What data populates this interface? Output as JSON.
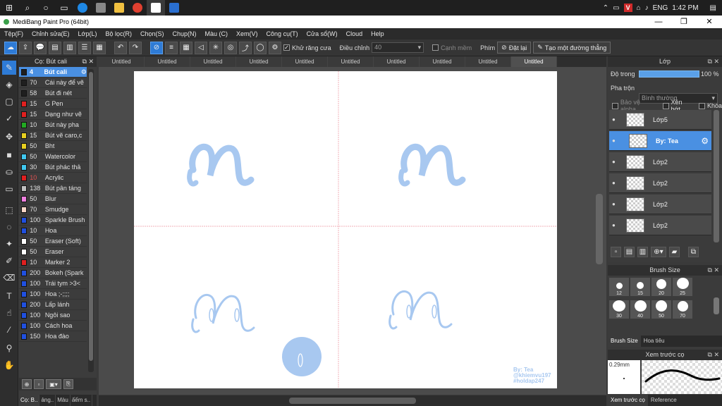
{
  "taskbar": {
    "icons": [
      "windows-logo",
      "search",
      "cortana",
      "task-view",
      "edge",
      "store",
      "explorer",
      "chrome",
      "medibang",
      "app"
    ],
    "tray": {
      "lang": "ENG",
      "time": "1:42 PM"
    }
  },
  "window": {
    "title": "MediBang Paint Pro (64bit)",
    "minimize": "—",
    "maximize": "❐",
    "close": "✕"
  },
  "menu": [
    "Tệp(F)",
    "Chỉnh sửa(E)",
    "Lớp(L)",
    "Bộ lọc(R)",
    "Chọn(S)",
    "Chụp(N)",
    "Màu (C)",
    "Xem(V)",
    "Công cụ(T)",
    "Cửa sổ(W)",
    "Cloud",
    "Help"
  ],
  "toolbar": {
    "antialias_label": "Khử răng cưa",
    "adjust_label": "Điều chỉnh",
    "adjust_value": "40",
    "snap_edge_label": "Cạnh mềm",
    "key_label": "Phím",
    "reset_label": "Đặt lại",
    "make_line_label": "Tạo một đường thẳng"
  },
  "brush_panel": {
    "title": "Cọ: Bút cali",
    "items": [
      {
        "size": "4",
        "name": "Bút cali",
        "color": "#1f1f1f",
        "selected": true
      },
      {
        "size": "70",
        "name": "Cái này để vẽ",
        "color": "#1f1f1f"
      },
      {
        "size": "58",
        "name": "Bút đi nét",
        "color": "#1f1f1f"
      },
      {
        "size": "15",
        "name": "G Pen",
        "color": "#e02020"
      },
      {
        "size": "15",
        "name": "Dạng như vẽ",
        "color": "#e02020"
      },
      {
        "size": "10",
        "name": "Bút này pha",
        "color": "#22aa22"
      },
      {
        "size": "15",
        "name": "Bút vẽ caro,c",
        "color": "#e8d020"
      },
      {
        "size": "50",
        "name": "Bht",
        "color": "#e8d020"
      },
      {
        "size": "50",
        "name": "Watercolor",
        "color": "#40c8f0"
      },
      {
        "size": "30",
        "name": "Bút phác thả",
        "color": "#40c8f0"
      },
      {
        "size": "10",
        "name": "Acrylic",
        "color": "#e02020",
        "accent": true
      },
      {
        "size": "138",
        "name": "Bút pân táng",
        "color": "#c0c0c0"
      },
      {
        "size": "50",
        "name": "Blur",
        "color": "#f080e0"
      },
      {
        "size": "70",
        "name": "Smudge",
        "color": "#f8d8c8"
      },
      {
        "size": "100",
        "name": "Sparkle Brush",
        "color": "#2050e0"
      },
      {
        "size": "10",
        "name": "Hoa",
        "color": "#2050e0"
      },
      {
        "size": "50",
        "name": "Eraser (Soft)",
        "color": "#ffffff"
      },
      {
        "size": "50",
        "name": "Eraser",
        "color": "#ffffff"
      },
      {
        "size": "10",
        "name": "Marker 2",
        "color": "#e02020"
      },
      {
        "size": "200",
        "name": "Bokeh (Spark",
        "color": "#2050e0"
      },
      {
        "size": "100",
        "name": "Trái tym >3<",
        "color": "#2050e0"
      },
      {
        "size": "100",
        "name": "Hoa ;-;;;;",
        "color": "#2050e0"
      },
      {
        "size": "200",
        "name": "Lấp lánh",
        "color": "#2050e0"
      },
      {
        "size": "100",
        "name": "Ngôi sao",
        "color": "#2050e0"
      },
      {
        "size": "100",
        "name": "Cách hoa",
        "color": "#2050e0"
      },
      {
        "size": "150",
        "name": "Hoa đào",
        "color": "#2050e0"
      }
    ],
    "tabs": [
      "Cọ: B..",
      "ảng..",
      "Màu",
      "ấếm s.."
    ]
  },
  "doc_tabs": [
    "Untitled",
    "Untitled",
    "Untitled",
    "Untitled",
    "Untitled",
    "Untitled",
    "Untitled",
    "Untitled",
    "Untitled",
    "Untitled"
  ],
  "canvas": {
    "signature": "By: Tea",
    "handle1": "@khiemvu197",
    "handle2": "#holdap247"
  },
  "layer_panel": {
    "title": "Lớp",
    "opacity_label": "Độ trong",
    "opacity_value": "100 %",
    "blend_label": "Pha trộn",
    "blend_value": "Bình thường",
    "protect_alpha": "Bảo vệ alpha",
    "clip": "Xén bớt",
    "lock": "Khóa",
    "layers": [
      {
        "name": "Lớp5"
      },
      {
        "name": "By: Tea",
        "selected": true
      },
      {
        "name": "Lớp2"
      },
      {
        "name": "Lớp2"
      },
      {
        "name": "Lớp2"
      },
      {
        "name": "Lớp2"
      }
    ]
  },
  "brush_size_panel": {
    "title": "Brush Size",
    "sizes": [
      "12",
      "15",
      "20",
      "25",
      "30",
      "40",
      "50",
      "70"
    ],
    "tabs": [
      "Brush Size",
      "Hoa tiêu"
    ]
  },
  "preview_panel": {
    "title": "Xem trước cọ",
    "size_value": "0.29mm",
    "tabs": [
      "Xem trước cọ",
      "Reference"
    ]
  },
  "colors": {
    "accent": "#4a90e2",
    "stroke": "#a8c8f0",
    "guide": "#f0a0a8"
  }
}
